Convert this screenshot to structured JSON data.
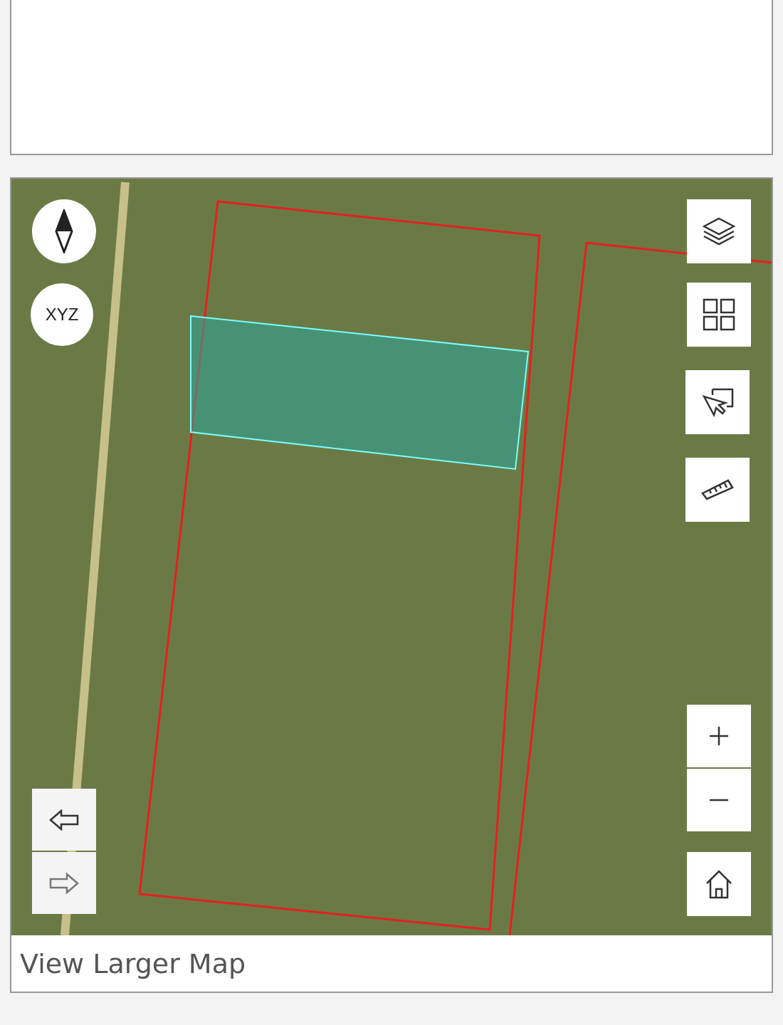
{
  "map": {
    "coordinate_button": {
      "label": "XYZ"
    },
    "larger_map_link": {
      "label": "View Larger Map"
    }
  }
}
